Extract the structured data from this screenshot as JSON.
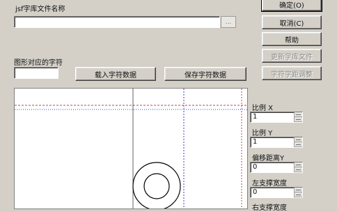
{
  "file_section": {
    "label": "jsf字库文件名称",
    "path_value": "",
    "browse_label": "..."
  },
  "char_section": {
    "label": "图形对应的字符",
    "char_value": "",
    "load_button": "载入字符数据",
    "save_button": "保存字符数据"
  },
  "buttons": {
    "ok": "确定(O)",
    "cancel": "取消(C)",
    "help": "帮助",
    "update_library": "更新字库文件",
    "adjust_spacing": "字符字距调整"
  },
  "params": {
    "scale_x": {
      "label": "比例 X",
      "value": "1"
    },
    "scale_y": {
      "label": "比例 Y",
      "value": "1"
    },
    "offset_y": {
      "label": "偏移距离Y",
      "value": "0"
    },
    "left_width": {
      "label": "左支撑宽度",
      "value": "0"
    },
    "right_width": {
      "label": "右支撑宽度",
      "value": ""
    }
  },
  "colors": {
    "guide_red": "#c04050",
    "guide_blue": "#3a3ad0",
    "glyph": "#000000"
  }
}
